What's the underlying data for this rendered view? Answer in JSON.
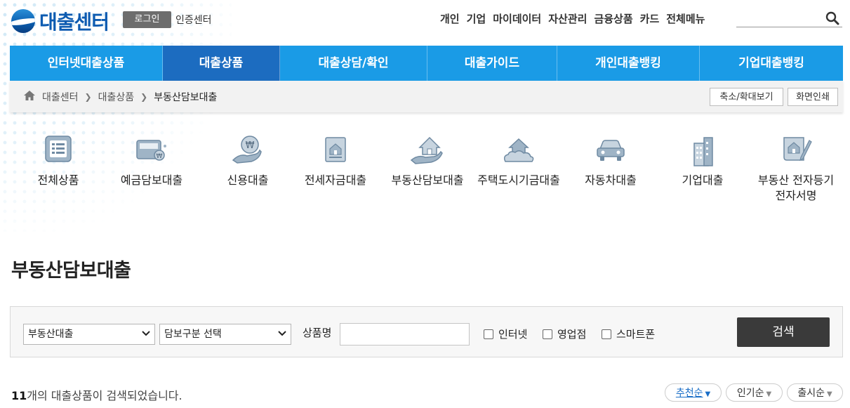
{
  "brand": {
    "name": "대출센터"
  },
  "header": {
    "login_label": "로그인",
    "cert_label": "인증센터",
    "nav": [
      "개인",
      "기업",
      "마이데이터",
      "자산관리",
      "금융상품",
      "카드",
      "전체메뉴"
    ]
  },
  "gnb": [
    "인터넷대출상품",
    "대출상품",
    "대출상담/확인",
    "대출가이드",
    "개인대출뱅킹",
    "기업대출뱅킹"
  ],
  "breadcrumb": {
    "items": [
      "대출센터",
      "대출상품"
    ],
    "current": "부동산담보대출",
    "zoom_label": "축소/확대보기",
    "print_label": "화면인쇄"
  },
  "categories": [
    {
      "label": "전체상품",
      "icon": "list-icon"
    },
    {
      "label": "예금담보대출",
      "icon": "passbook-icon"
    },
    {
      "label": "신용대출",
      "icon": "coin-hand-icon"
    },
    {
      "label": "전세자금대출",
      "icon": "house-document-icon"
    },
    {
      "label": "부동산담보대출",
      "icon": "house-hand-icon"
    },
    {
      "label": "주택도시기금대출",
      "icon": "house-cloud-icon"
    },
    {
      "label": "자동차대출",
      "icon": "car-icon"
    },
    {
      "label": "기업대출",
      "icon": "building-icon"
    },
    {
      "label": "부동산 전자등기\n전자서명",
      "icon": "scroll-pen-icon"
    }
  ],
  "page_title": "부동산담보대출",
  "filter": {
    "type_select": "부동산대출",
    "collateral_select": "담보구분 선택",
    "product_name_label": "상품명",
    "product_name_value": "",
    "checkboxes": [
      {
        "label": "인터넷",
        "checked": false
      },
      {
        "label": "영업점",
        "checked": false
      },
      {
        "label": "스마트폰",
        "checked": false
      }
    ],
    "search_label": "검색"
  },
  "result": {
    "count": "11",
    "text": "개의 대출상품이 검색되었습니다."
  },
  "sort": [
    {
      "label": "추천순",
      "active": true
    },
    {
      "label": "인기순",
      "active": false
    },
    {
      "label": "출시순",
      "active": false
    }
  ]
}
